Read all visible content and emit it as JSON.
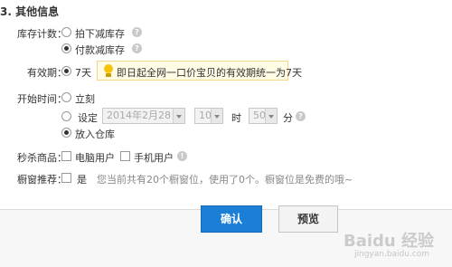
{
  "section": {
    "title": "3. 其他信息"
  },
  "stock": {
    "label": "库存计数：",
    "options": [
      "拍下减库存",
      "付款减库存"
    ]
  },
  "validity": {
    "label": "有效期：",
    "option": "7天",
    "tip": "即日起全网一口价宝贝的有效期统一为7天"
  },
  "start": {
    "label": "开始时间：",
    "now": "立刻",
    "set": "设定",
    "date": "2014年2月28日",
    "hour": "10",
    "hour_unit": "时",
    "minute": "50",
    "minute_unit": "分",
    "warehouse": "放入仓库"
  },
  "flash": {
    "label": "秒杀商品：",
    "pc": "电脑用户",
    "mobile": "手机用户"
  },
  "showcase": {
    "label": "橱窗推荐：",
    "option": "是",
    "hint": "您当前共有20个橱窗位，使用了0个。橱窗位是免费的哦~"
  },
  "buttons": {
    "confirm": "确认",
    "preview": "预览"
  },
  "watermark": {
    "main": "Baidu 经验",
    "sub": "jingyan.baidu.com"
  }
}
